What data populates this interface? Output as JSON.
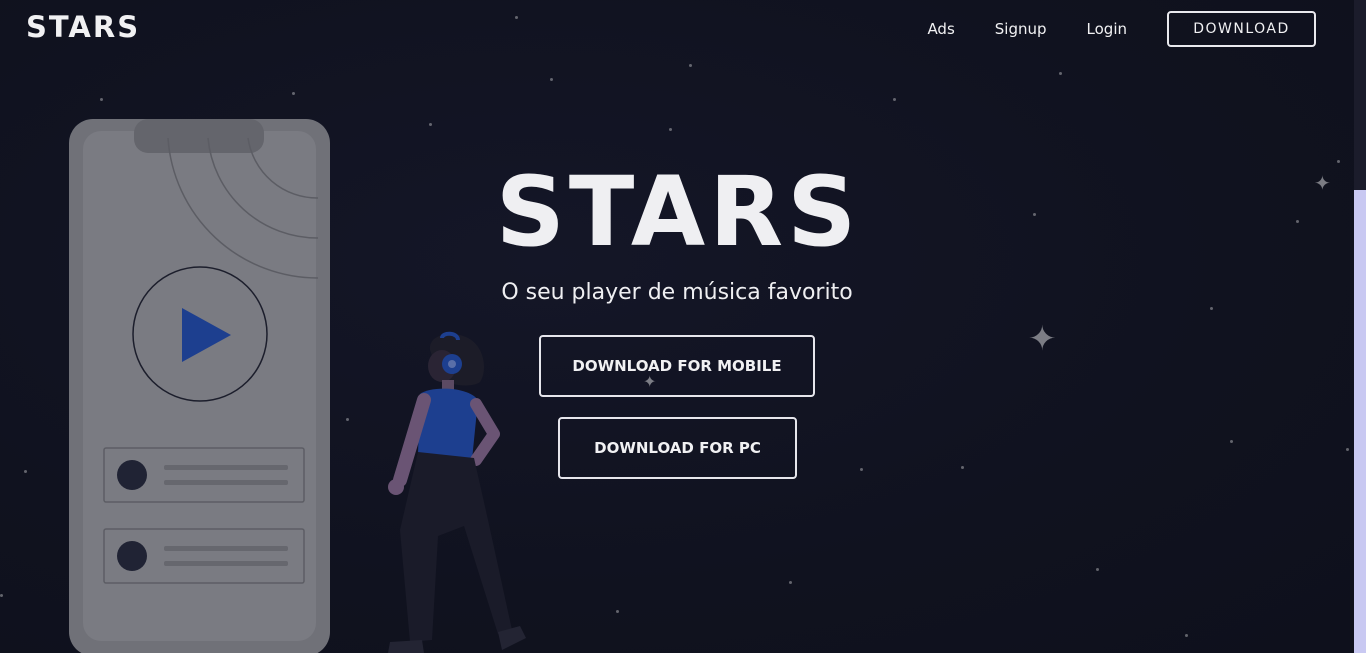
{
  "header": {
    "logo": "STARS",
    "nav": {
      "ads": "Ads",
      "signup": "Signup",
      "login": "Login",
      "download": "DOWNLOAD"
    }
  },
  "hero": {
    "title": "STARS",
    "subtitle": "O seu player de música favorito",
    "download_mobile": "DOWNLOAD FOR MOBILE",
    "download_pc": "DOWNLOAD FOR PC"
  },
  "colors": {
    "background": "#111322",
    "text": "#ececf0",
    "phone_body": "#6e6f76",
    "accent_blue": "#1d3f8f",
    "scrollbar_track": "#c9c9f2"
  },
  "icons": {
    "play": "play-icon",
    "headphones": "headphones-icon"
  }
}
